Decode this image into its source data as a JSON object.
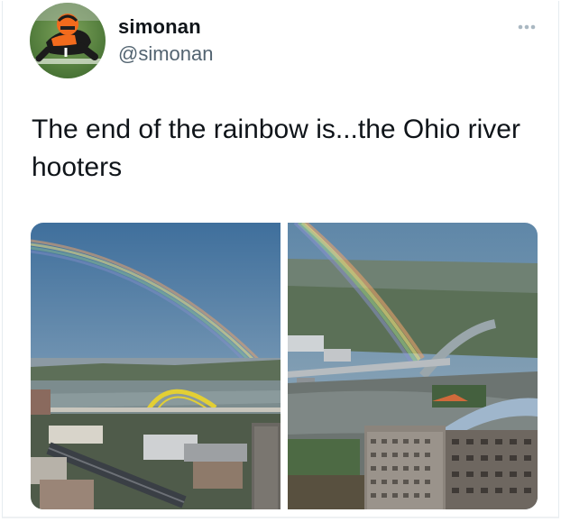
{
  "tweet": {
    "author": {
      "display_name": "simonan",
      "handle": "@simonan",
      "avatar_icon": "football-player-avatar"
    },
    "more_icon": "more-dots-icon",
    "text": "The end of the rainbow is...the Ohio river hooters",
    "media": [
      {
        "name": "rainbow-over-bridge-photo"
      },
      {
        "name": "rainbow-over-river-city-photo"
      }
    ]
  },
  "colors": {
    "text_primary": "#0f1419",
    "text_secondary": "#536471",
    "more_dots": "#aab8c2"
  }
}
